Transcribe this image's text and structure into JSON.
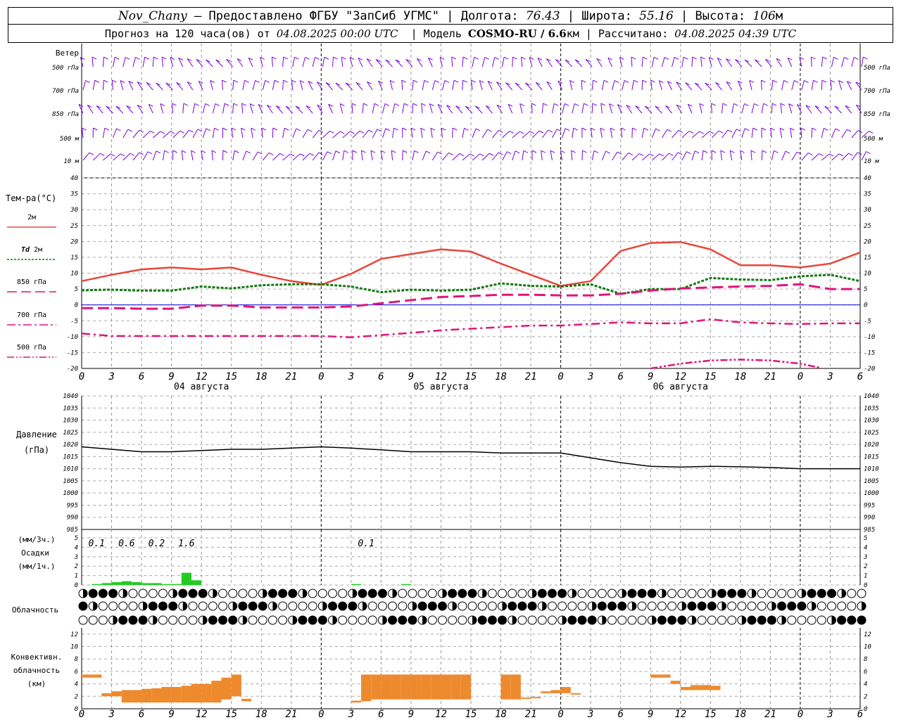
{
  "header": {
    "station": "Nov_Chany",
    "dash": " – ",
    "provider": "Предоставлено ФГБУ \"ЗапСиб УГМС\"",
    "lon_label": " | Долгота: ",
    "lon": "76.43",
    "lat_label": " | Широта: ",
    "lat": "55.16",
    "alt_label": " | Высота: ",
    "alt": "106",
    "alt_unit": "м",
    "forecast_label": "Прогноз на 120 часа(ов) от ",
    "forecast_from": "04.08.2025 00:00 UTC",
    "model_label": "  | Модель ",
    "model": "COSMO-RU / 6.6",
    "model_unit": "км",
    "calc_label": " | Рассчитано: ",
    "calc_time": "04.08.2025 04:39 UTC"
  },
  "colors": {
    "t2m": "#e8473b",
    "td2m": "#107a10",
    "t850": "#e0147a",
    "wind": "#7a00d8",
    "precip": "#22cc22",
    "conv": "#ee8a2e",
    "pressure": "#000000",
    "zero_line": "#0000cc"
  },
  "chart_data": [
    {
      "type": "wind_barbs",
      "name": "wind",
      "title": "Ветер",
      "levels": [
        "500 гПа",
        "700 гПа",
        "850 гПа",
        "500 м",
        "10 м"
      ]
    },
    {
      "type": "line",
      "title": "Тем-ра(°C)",
      "ylim": [
        -20,
        40
      ],
      "yticks": [
        -20,
        -15,
        -10,
        -5,
        0,
        5,
        10,
        15,
        20,
        25,
        30,
        35,
        40
      ],
      "xticks": [
        "0",
        "3",
        "6",
        "9",
        "12",
        "15",
        "18",
        "21",
        "0",
        "3",
        "6",
        "9",
        "12",
        "15",
        "18",
        "21",
        "0",
        "3",
        "6",
        "9",
        "12",
        "15",
        "18",
        "21",
        "0",
        "3",
        "6"
      ],
      "day_labels": [
        "04 августа",
        "05 августа",
        "06 августа"
      ],
      "legend": [
        {
          "label": "2м",
          "color": "#e8473b",
          "style": "solid"
        },
        {
          "label": "Td 2м",
          "label_prefix": "Td",
          "label_suffix": " 2м",
          "color": "#107a10",
          "style": "dotted"
        },
        {
          "label": "850 гПа",
          "color": "#e0147a",
          "style": "dashed"
        },
        {
          "label": "700 гПа",
          "color": "#e0147a",
          "style": "dashdot"
        },
        {
          "label": "500 гПа",
          "color": "#e0147a",
          "style": "dashdotdot"
        }
      ],
      "series": [
        {
          "name": "2м",
          "x": [
            0,
            3,
            6,
            9,
            12,
            15,
            18,
            21,
            24,
            27,
            30,
            33,
            36,
            39,
            42,
            45,
            48,
            51,
            54,
            57,
            60,
            63,
            66,
            69,
            72,
            75,
            78
          ],
          "values": [
            7.5,
            9.5,
            11.2,
            11.8,
            11.2,
            11.8,
            9.5,
            7.5,
            6.3,
            9.8,
            14.5,
            16.0,
            17.5,
            16.8,
            13.0,
            9.5,
            6.0,
            7.5,
            17.0,
            19.5,
            19.8,
            17.5,
            12.5,
            12.5,
            11.8,
            13.0,
            16.5
          ]
        },
        {
          "name": "Td 2м",
          "x": [
            0,
            3,
            6,
            9,
            12,
            15,
            18,
            21,
            24,
            27,
            30,
            33,
            36,
            39,
            42,
            45,
            48,
            51,
            54,
            57,
            60,
            63,
            66,
            69,
            72,
            75,
            78
          ],
          "values": [
            4.6,
            4.8,
            4.5,
            4.5,
            5.8,
            5.2,
            6.2,
            6.5,
            6.5,
            5.8,
            4.0,
            4.8,
            4.5,
            4.8,
            6.8,
            6.0,
            5.8,
            6.5,
            3.5,
            5.0,
            5.0,
            8.5,
            8.0,
            7.8,
            9.0,
            9.5,
            7.5
          ]
        },
        {
          "name": "850 гПа",
          "x": [
            0,
            3,
            6,
            9,
            12,
            15,
            18,
            21,
            24,
            27,
            30,
            33,
            36,
            39,
            42,
            45,
            48,
            51,
            54,
            57,
            60,
            63,
            66,
            69,
            72,
            75,
            78
          ],
          "values": [
            -1.0,
            -1.0,
            -1.2,
            -1.2,
            -0.2,
            -0.2,
            -0.8,
            -0.8,
            -0.8,
            -0.5,
            0.5,
            1.5,
            2.5,
            2.8,
            3.2,
            3.2,
            3.0,
            3.0,
            3.5,
            4.5,
            5.2,
            5.5,
            5.8,
            6.0,
            6.5,
            5.0,
            5.0
          ]
        },
        {
          "name": "700 гПа",
          "x": [
            0,
            3,
            6,
            9,
            12,
            15,
            18,
            21,
            24,
            27,
            30,
            33,
            36,
            39,
            42,
            45,
            48,
            51,
            54,
            57,
            60,
            63,
            66,
            69,
            72,
            75,
            78
          ],
          "values": [
            -9.0,
            -9.8,
            -9.8,
            -9.8,
            -9.8,
            -9.8,
            -9.8,
            -9.8,
            -9.8,
            -10.2,
            -9.5,
            -8.8,
            -8.0,
            -7.5,
            -7.0,
            -6.5,
            -6.5,
            -6.0,
            -5.5,
            -5.8,
            -5.8,
            -4.5,
            -5.5,
            -5.8,
            -6.0,
            -5.8,
            -5.8
          ]
        },
        {
          "name": "500 гПа",
          "x": [
            57,
            60,
            63,
            66,
            69,
            72,
            74
          ],
          "values": [
            -20.0,
            -18.5,
            -17.5,
            -17.2,
            -17.5,
            -18.5,
            -19.8
          ]
        }
      ]
    },
    {
      "type": "line",
      "name": "pressure",
      "title": "Давление",
      "unit": "(гПа)",
      "ylim": [
        985,
        1040
      ],
      "yticks": [
        985,
        990,
        995,
        1000,
        1005,
        1010,
        1015,
        1020,
        1025,
        1030,
        1035,
        1040
      ],
      "series": [
        {
          "name": "pressure",
          "x": [
            0,
            3,
            6,
            9,
            12,
            15,
            18,
            21,
            24,
            27,
            30,
            33,
            36,
            39,
            42,
            45,
            48,
            51,
            54,
            57,
            60,
            63,
            66,
            69,
            72,
            75,
            78
          ],
          "values": [
            1019,
            1018,
            1017,
            1017,
            1017.5,
            1018,
            1018,
            1018.5,
            1019,
            1018.5,
            1017.8,
            1017,
            1017,
            1017,
            1016.5,
            1016.5,
            1016.5,
            1014.5,
            1012.5,
            1011,
            1010.7,
            1011,
            1010.8,
            1010.5,
            1010,
            1010,
            1010
          ]
        }
      ]
    },
    {
      "type": "bar",
      "name": "precip",
      "title": "Осадки",
      "unit_3h": "(мм/3ч.)",
      "unit_1h": "(мм/1ч.)",
      "ylim": [
        0,
        5
      ],
      "yticks": [
        0,
        1,
        2,
        3,
        4,
        5
      ],
      "x": [
        1,
        2,
        3,
        4,
        5,
        6,
        7,
        8,
        9,
        10,
        11,
        27,
        32
      ],
      "values": [
        0.1,
        0.2,
        0.3,
        0.4,
        0.3,
        0.2,
        0.2,
        0.1,
        0.1,
        1.3,
        0.5,
        0.1,
        0.1
      ],
      "labels": [
        "0.1",
        "0.6",
        "0.2",
        "1.6",
        "0.1"
      ],
      "label_x": [
        1.5,
        4.5,
        7.5,
        10.5,
        28.5
      ]
    },
    {
      "type": "cloud_symbols",
      "name": "cloudiness",
      "title": "Облачность",
      "rows": 3
    },
    {
      "type": "bar",
      "name": "convective",
      "title": "Конвективн.",
      "title2": "облачность",
      "unit": "(км)",
      "ylim": [
        0,
        13
      ],
      "yticks": [
        0,
        2,
        4,
        6,
        8,
        10,
        12
      ],
      "series": [
        {
          "name": "bottom",
          "x": [
            0,
            1,
            2,
            3,
            4,
            5,
            6,
            7,
            8,
            9,
            10,
            11,
            12,
            13,
            14,
            15,
            16,
            27,
            28,
            29,
            30,
            31,
            32,
            33,
            34,
            35,
            36,
            37,
            38,
            42,
            43,
            44,
            45,
            46,
            47,
            48,
            49,
            57,
            58,
            59,
            60,
            61,
            62,
            63
          ],
          "values": [
            5,
            5,
            2,
            2,
            1,
            1,
            1,
            1,
            1,
            1,
            1,
            1,
            1,
            1,
            1.5,
            2,
            1.2,
            1,
            1.2,
            1.5,
            1.5,
            1.5,
            1.5,
            1.5,
            1.5,
            1.5,
            1.5,
            1.5,
            1.5,
            1.5,
            1.5,
            2.2,
            2.5,
            2.5,
            2.5,
            2.5,
            2.5,
            5,
            5,
            4,
            3,
            3,
            3,
            3
          ]
        },
        {
          "name": "top",
          "x": [
            0,
            1,
            2,
            3,
            4,
            5,
            6,
            7,
            8,
            9,
            10,
            11,
            12,
            13,
            14,
            15,
            16,
            27,
            28,
            29,
            30,
            31,
            32,
            33,
            34,
            35,
            36,
            37,
            38,
            42,
            43,
            44,
            45,
            46,
            47,
            48,
            49,
            57,
            58,
            59,
            60,
            61,
            62,
            63
          ],
          "values": [
            5.5,
            5.5,
            2.5,
            2.8,
            3,
            3,
            3.2,
            3.3,
            3.5,
            3.5,
            3.7,
            4,
            4,
            4.5,
            5,
            5.5,
            1.6,
            1.3,
            5.5,
            5.5,
            5.5,
            5.5,
            5.5,
            5.5,
            5.5,
            5.5,
            5.5,
            5.5,
            5.5,
            5.5,
            5.5,
            1.8,
            1.9,
            2.8,
            3,
            3.5,
            2.5,
            5.5,
            5.5,
            4.5,
            3.5,
            3.8,
            3.8,
            3.7
          ]
        }
      ]
    }
  ]
}
